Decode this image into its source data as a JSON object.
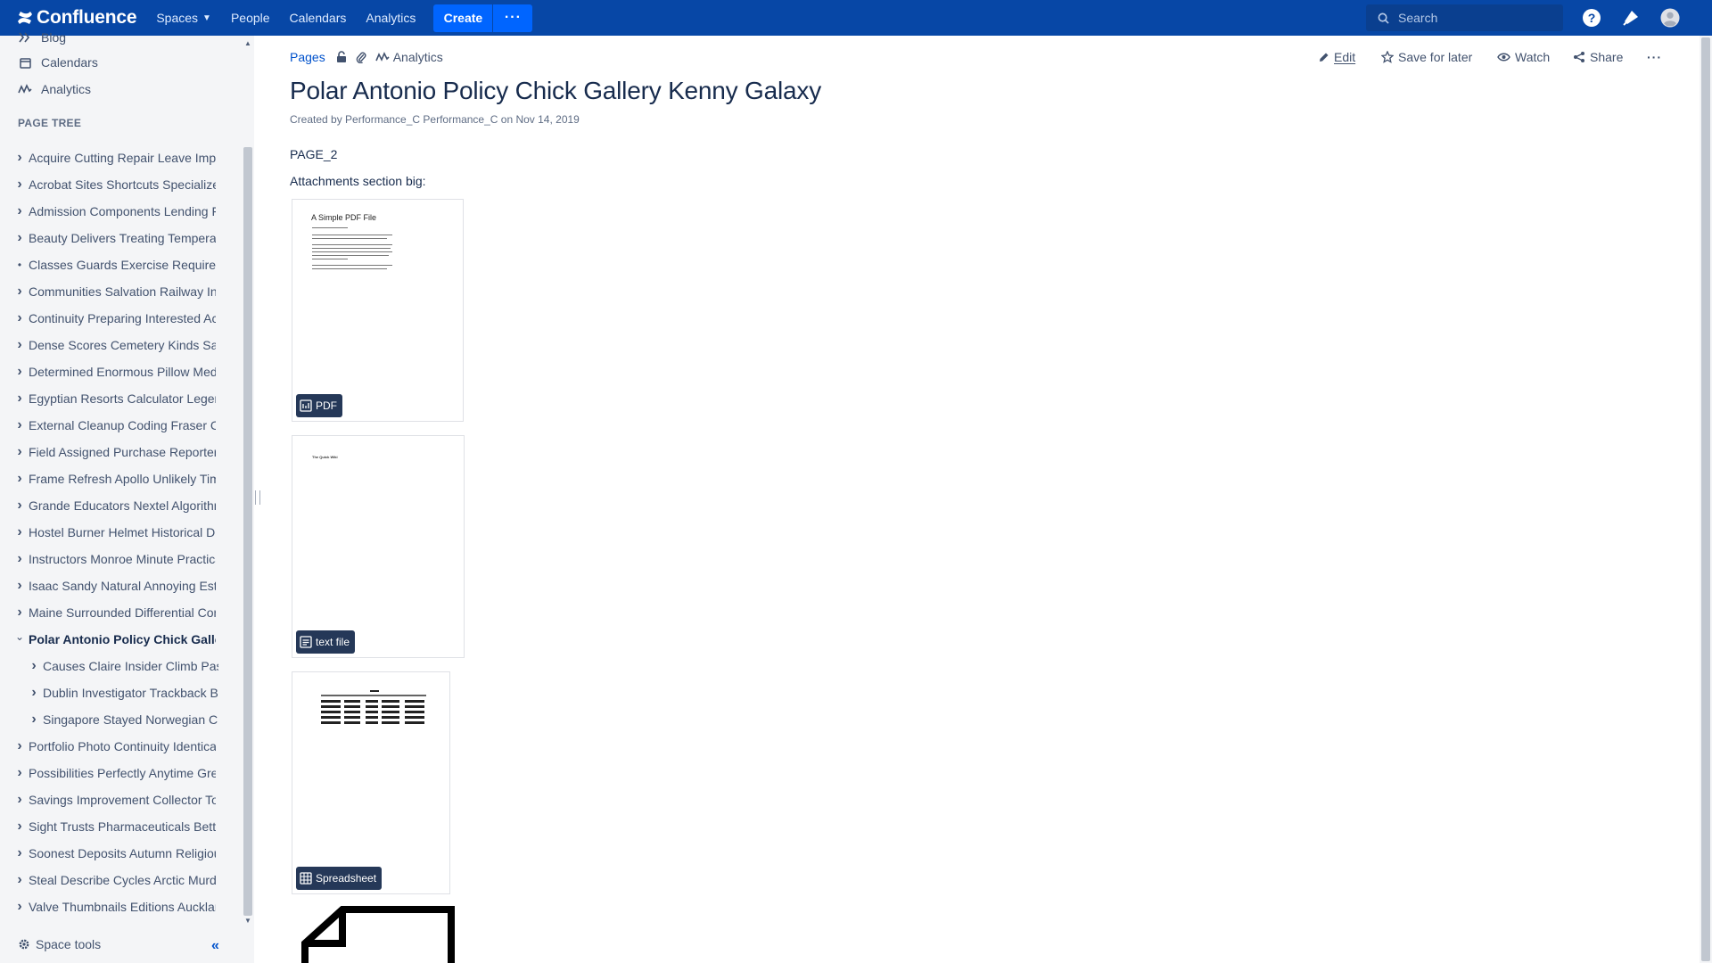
{
  "topnav": {
    "logo": "Confluence",
    "spaces": "Spaces",
    "people": "People",
    "calendars": "Calendars",
    "analytics": "Analytics",
    "create": "Create",
    "more": "···",
    "search_placeholder": "Search"
  },
  "sidebar": {
    "links": [
      {
        "label": "Blog",
        "icon": "quote-icon"
      },
      {
        "label": "Calendars",
        "icon": "calendar-icon"
      },
      {
        "label": "Analytics",
        "icon": "analytics-icon"
      }
    ],
    "tree_heading": "PAGE TREE",
    "tree": [
      {
        "label": "Acquire Cutting Repair Leave Implementation",
        "chevron": "›",
        "level": 0
      },
      {
        "label": "Acrobat Sites Shortcuts Specialized",
        "chevron": "›",
        "level": 0
      },
      {
        "label": "Admission Components Lending Factors",
        "chevron": "›",
        "level": 0
      },
      {
        "label": "Beauty Delivers Treating Temperature",
        "chevron": "›",
        "level": 0
      },
      {
        "label": "Classes Guards Exercise Requirements",
        "chevron": "•",
        "level": 0
      },
      {
        "label": "Communities Salvation Railway Infrastructure",
        "chevron": "›",
        "level": 0
      },
      {
        "label": "Continuity Preparing Interested Accounts",
        "chevron": "›",
        "level": 0
      },
      {
        "label": "Dense Scores Cemetery Kinds Saturday",
        "chevron": "›",
        "level": 0
      },
      {
        "label": "Determined Enormous Pillow Medications",
        "chevron": "›",
        "level": 0
      },
      {
        "label": "Egyptian Resorts Calculator Legends",
        "chevron": "›",
        "level": 0
      },
      {
        "label": "External Cleanup Coding Fraser Cables",
        "chevron": "›",
        "level": 0
      },
      {
        "label": "Field Assigned Purchase Reporters",
        "chevron": "›",
        "level": 0
      },
      {
        "label": "Frame Refresh Apollo Unlikely Timing",
        "chevron": "›",
        "level": 0
      },
      {
        "label": "Grande Educators Nextel Algorithms",
        "chevron": "›",
        "level": 0
      },
      {
        "label": "Hostel Burner Helmet Historical Duties",
        "chevron": "›",
        "level": 0
      },
      {
        "label": "Instructors Monroe Minute Practical",
        "chevron": "›",
        "level": 0
      },
      {
        "label": "Isaac Sandy Natural Annoying Estimates",
        "chevron": "›",
        "level": 0
      },
      {
        "label": "Maine Surrounded Differential Contracts",
        "chevron": "›",
        "level": 0
      },
      {
        "label": "Polar Antonio Policy Chick Gallery Kenny Galaxy",
        "chevron": "⌄",
        "level": 0,
        "active": true
      },
      {
        "label": "Causes Claire Insider Climb Passes",
        "chevron": "›",
        "level": 1
      },
      {
        "label": "Dublin Investigator Trackback Bumper",
        "chevron": "›",
        "level": 1
      },
      {
        "label": "Singapore Stayed Norwegian Clusters",
        "chevron": "›",
        "level": 1
      },
      {
        "label": "Portfolio Photo Continuity Identical",
        "chevron": "›",
        "level": 0
      },
      {
        "label": "Possibilities Perfectly Anytime Greetings",
        "chevron": "›",
        "level": 0
      },
      {
        "label": "Savings Improvement Collector Toolkit",
        "chevron": "›",
        "level": 0
      },
      {
        "label": "Sight Trusts Pharmaceuticals Betting",
        "chevron": "›",
        "level": 0
      },
      {
        "label": "Soonest Deposits Autumn Religious",
        "chevron": "›",
        "level": 0
      },
      {
        "label": "Steal Describe Cycles Arctic Murder",
        "chevron": "›",
        "level": 0
      },
      {
        "label": "Valve Thumbnails Editions Auckland",
        "chevron": "›",
        "level": 0
      }
    ],
    "space_tools": "Space tools",
    "collapse": "«"
  },
  "breadcrumbs": {
    "pages": "Pages",
    "analytics": "Analytics"
  },
  "actions": {
    "edit": "Edit",
    "save_for_later": "Save for later",
    "watch": "Watch",
    "share": "Share",
    "more": "···"
  },
  "page": {
    "title": "Polar Antonio Policy Chick Gallery Kenny Galaxy",
    "meta": "Created by Performance_C Performance_C on Nov 14, 2019",
    "body_line1": "PAGE_2",
    "body_line2": "Attachments section big:"
  },
  "attachments": [
    {
      "type": "PDF",
      "preview_title": "A Simple PDF File"
    },
    {
      "type": "text file",
      "preview_title": "The Quick Wiki"
    },
    {
      "type": "Spreadsheet"
    }
  ]
}
